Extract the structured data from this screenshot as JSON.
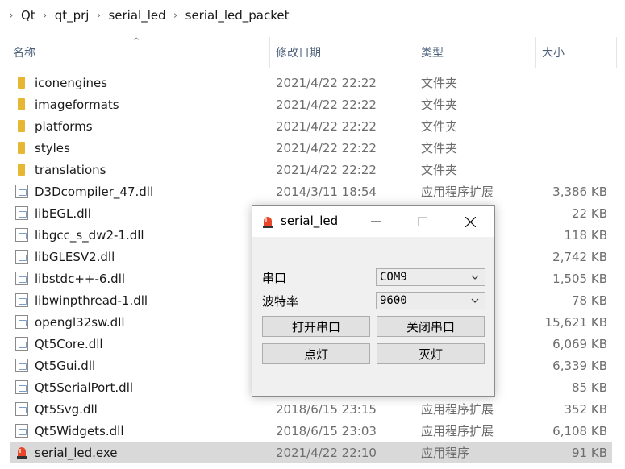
{
  "breadcrumb": [
    "Qt",
    "qt_prj",
    "serial_led",
    "serial_led_packet"
  ],
  "columns": {
    "name": "名称",
    "date": "修改日期",
    "type": "类型",
    "size": "大小"
  },
  "files": [
    {
      "icon": "folder-icon",
      "name": "iconengines",
      "date": "2021/4/22 22:22",
      "type": "文件夹",
      "size": ""
    },
    {
      "icon": "folder-icon",
      "name": "imageformats",
      "date": "2021/4/22 22:22",
      "type": "文件夹",
      "size": ""
    },
    {
      "icon": "folder-icon",
      "name": "platforms",
      "date": "2021/4/22 22:22",
      "type": "文件夹",
      "size": ""
    },
    {
      "icon": "folder-icon",
      "name": "styles",
      "date": "2021/4/22 22:22",
      "type": "文件夹",
      "size": ""
    },
    {
      "icon": "folder-icon",
      "name": "translations",
      "date": "2021/4/22 22:22",
      "type": "文件夹",
      "size": ""
    },
    {
      "icon": "dll-icon",
      "name": "D3Dcompiler_47.dll",
      "date": "2014/3/11 18:54",
      "type": "应用程序扩展",
      "size": "3,386 KB"
    },
    {
      "icon": "dll-icon",
      "name": "libEGL.dll",
      "date": "",
      "type": "",
      "size": "22 KB"
    },
    {
      "icon": "dll-icon",
      "name": "libgcc_s_dw2-1.dll",
      "date": "",
      "type": "",
      "size": "118 KB"
    },
    {
      "icon": "dll-icon",
      "name": "libGLESV2.dll",
      "date": "",
      "type": "",
      "size": "2,742 KB"
    },
    {
      "icon": "dll-icon",
      "name": "libstdc++-6.dll",
      "date": "",
      "type": "",
      "size": "1,505 KB"
    },
    {
      "icon": "dll-icon",
      "name": "libwinpthread-1.dll",
      "date": "",
      "type": "",
      "size": "78 KB"
    },
    {
      "icon": "dll-icon",
      "name": "opengl32sw.dll",
      "date": "",
      "type": "",
      "size": "15,621 KB"
    },
    {
      "icon": "dll-icon",
      "name": "Qt5Core.dll",
      "date": "",
      "type": "",
      "size": "6,069 KB"
    },
    {
      "icon": "dll-icon",
      "name": "Qt5Gui.dll",
      "date": "",
      "type": "",
      "size": "6,339 KB"
    },
    {
      "icon": "dll-icon",
      "name": "Qt5SerialPort.dll",
      "date": "",
      "type": "",
      "size": "85 KB"
    },
    {
      "icon": "dll-icon",
      "name": "Qt5Svg.dll",
      "date": "2018/6/15 23:15",
      "type": "应用程序扩展",
      "size": "352 KB"
    },
    {
      "icon": "dll-icon",
      "name": "Qt5Widgets.dll",
      "date": "2018/6/15 23:03",
      "type": "应用程序扩展",
      "size": "6,108 KB"
    },
    {
      "icon": "exe-icon",
      "name": "serial_led.exe",
      "date": "2021/4/22 22:10",
      "type": "应用程序",
      "size": "91 KB",
      "selected": true
    }
  ],
  "dialog": {
    "title": "serial_led",
    "port_label": "串口",
    "port_value": "COM9",
    "baud_label": "波特率",
    "baud_value": "9600",
    "open_button": "打开串口",
    "close_button": "关闭串口",
    "light_on_button": "点灯",
    "light_off_button": "灭灯"
  },
  "colors": {
    "folder": "#e7b733",
    "selected_row": "#d9d9d9",
    "header_text": "#4c607a"
  }
}
